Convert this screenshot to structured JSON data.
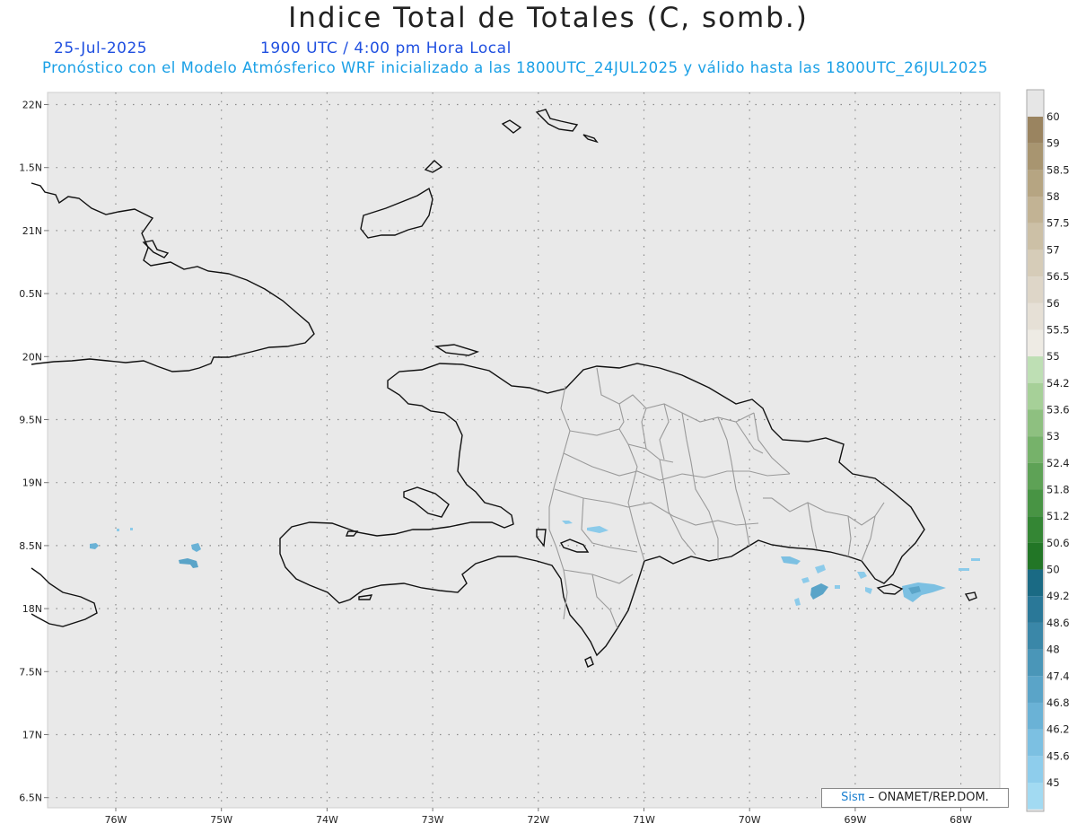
{
  "title": "Indice Total de Totales (C, somb.)",
  "date": "25-Jul-2025",
  "time": "1900 UTC / 4:00 pm Hora Local",
  "description": "Pronóstico con el Modelo Atmósferico WRF inicializado a las 1800UTC_24JUL2025 y válido hasta las  1800UTC_26JUL2025",
  "lat_labels": [
    "22N",
    "1.5N",
    "21N",
    "0.5N",
    "20N",
    "9.5N",
    "19N",
    "8.5N",
    "18N",
    "7.5N",
    "17N",
    "6.5N"
  ],
  "lon_labels": [
    "76W",
    "75W",
    "74W",
    "73W",
    "72W",
    "71W",
    "70W",
    "69W",
    "68W"
  ],
  "colorbar": {
    "labels": [
      "60",
      "59",
      "58.5",
      "58",
      "57.5",
      "57",
      "56.5",
      "56",
      "55.5",
      "55",
      "54.2",
      "53.6",
      "53",
      "52.4",
      "51.8",
      "51.2",
      "50.6",
      "50",
      "49.2",
      "48.6",
      "48",
      "47.4",
      "46.8",
      "46.2",
      "45.6",
      "45"
    ],
    "colors": [
      "#9a8460",
      "#a89570",
      "#b6a582",
      "#c2b394",
      "#ccc0a6",
      "#d6ccb8",
      "#ded6c8",
      "#e6e0d6",
      "#eeebe4",
      "#bedfb4",
      "#a6d098",
      "#8ec080",
      "#76b26a",
      "#5ea256",
      "#489444",
      "#348634",
      "#227626",
      "#1a6a84",
      "#2a7898",
      "#3a87a8",
      "#4a96b8",
      "#5aa4c8",
      "#6ab2d6",
      "#7cc0e2",
      "#8ecdec",
      "#a2daf2"
    ]
  },
  "credit": {
    "brand": "Sisπ",
    "text": "– ONAMET/REP.DOM."
  }
}
